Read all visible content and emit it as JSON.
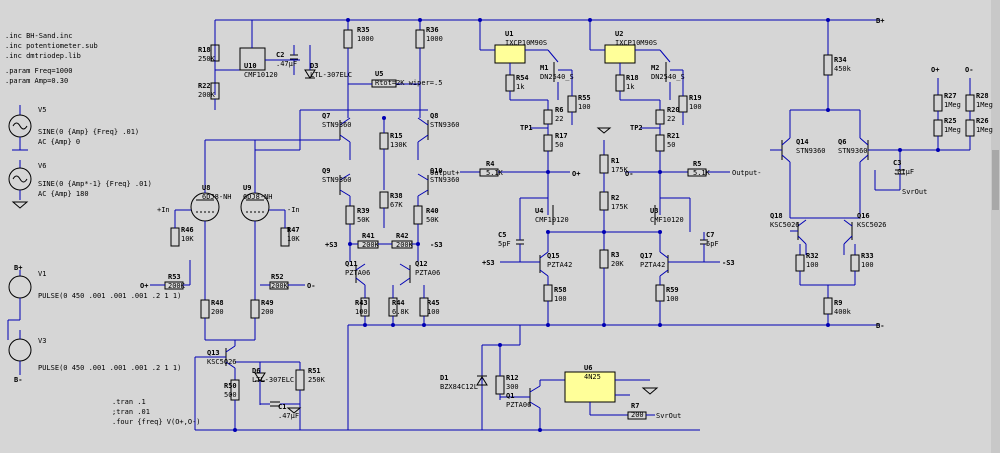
{
  "directives": {
    "inc1": ".inc BH-Sand.inc",
    "inc2": ".inc potentiometer.sub",
    "inc3": ".inc dmtriodep.lib",
    "param1": ".param Freq=1000",
    "param2": ".param Amp=0.30",
    "tran1": ".tran .1",
    "tran2": ";tran .01",
    "four": ".four {freq} V(O+,O-)"
  },
  "sources": {
    "v5": {
      "name": "V5",
      "spec": "SINE(0 {Amp} {Freq} .01)",
      "ac": "AC {Amp} 0"
    },
    "v6": {
      "name": "V6",
      "spec": "SINE(0 {Amp*-1} {Freq} .01)",
      "ac": "AC {Amp} 180"
    },
    "v1": {
      "name": "V1",
      "spec": "PULSE(0 450 .001 .001 .001 .2 1 1)"
    },
    "v3": {
      "name": "V3",
      "spec": "PULSE(0 450 .001 .001 .001 .2 1 1)"
    }
  },
  "nets": {
    "bplus": "B+",
    "bminus": "B-",
    "in_p": "+In",
    "in_m": "-In",
    "o_p": "O+",
    "o_m": "O-",
    "s3p": "+S3",
    "s3m": "-S3",
    "out_p": "Output+",
    "out_m": "Output-",
    "svrout": "SvrOut"
  },
  "components": [
    {
      "ref": "R18",
      "val": "250K"
    },
    {
      "ref": "R22",
      "val": "200K"
    },
    {
      "ref": "U10",
      "val": "CMF10120"
    },
    {
      "ref": "C2",
      "val": ".47µF"
    },
    {
      "ref": "D3",
      "val": "LTL-307ELC"
    },
    {
      "ref": "R35",
      "val": "1000"
    },
    {
      "ref": "R36",
      "val": "1000"
    },
    {
      "ref": "U5",
      "val": "Rtot=2K wiper=.5"
    },
    {
      "ref": "Q7",
      "val": "STN9360"
    },
    {
      "ref": "Q8",
      "val": "STN9360"
    },
    {
      "ref": "R15",
      "val": "130K"
    },
    {
      "ref": "Q9",
      "val": "STN9360"
    },
    {
      "ref": "Q10",
      "val": "STN9360"
    },
    {
      "ref": "R38",
      "val": "67K"
    },
    {
      "ref": "R39",
      "val": "50K"
    },
    {
      "ref": "R40",
      "val": "50K"
    },
    {
      "ref": "R41",
      "val": "200K"
    },
    {
      "ref": "R42",
      "val": "200K"
    },
    {
      "ref": "Q11",
      "val": "PZTA06"
    },
    {
      "ref": "Q12",
      "val": "PZTA06"
    },
    {
      "ref": "R43",
      "val": "100"
    },
    {
      "ref": "R44",
      "val": "6.8K"
    },
    {
      "ref": "R45",
      "val": "100"
    },
    {
      "ref": "U8",
      "val": "6DJ8-NH"
    },
    {
      "ref": "U9",
      "val": "6DJ8-NH"
    },
    {
      "ref": "R46",
      "val": "10K"
    },
    {
      "ref": "R47",
      "val": "10K"
    },
    {
      "ref": "R53",
      "val": "200K"
    },
    {
      "ref": "R52",
      "val": "200K"
    },
    {
      "ref": "R48",
      "val": "200"
    },
    {
      "ref": "R49",
      "val": "200"
    },
    {
      "ref": "Q13",
      "val": "KSC5026"
    },
    {
      "ref": "D6",
      "val": "LTL-307ELC"
    },
    {
      "ref": "R51",
      "val": "250K"
    },
    {
      "ref": "R50",
      "val": "500"
    },
    {
      "ref": "C1",
      "val": ".47µF"
    },
    {
      "ref": "U1",
      "val": "IXCP10M90S"
    },
    {
      "ref": "U2",
      "val": "IXCP10M90S"
    },
    {
      "ref": "R54",
      "val": "1k"
    },
    {
      "ref": "R18b",
      "val": "1k"
    },
    {
      "ref": "M1",
      "val": "DN2540_S"
    },
    {
      "ref": "M2",
      "val": "DN2540_S"
    },
    {
      "ref": "R6",
      "val": "22"
    },
    {
      "ref": "R20",
      "val": "22"
    },
    {
      "ref": "R55",
      "val": "100"
    },
    {
      "ref": "R19",
      "val": "100"
    },
    {
      "ref": "R17",
      "val": "50"
    },
    {
      "ref": "R21",
      "val": "50"
    },
    {
      "ref": "TP1",
      "val": ""
    },
    {
      "ref": "TP2",
      "val": ""
    },
    {
      "ref": "R4",
      "val": "5.1K"
    },
    {
      "ref": "R5",
      "val": "5.1K"
    },
    {
      "ref": "R1",
      "val": "175K"
    },
    {
      "ref": "R2",
      "val": "175K"
    },
    {
      "ref": "U4",
      "val": "CMF10120"
    },
    {
      "ref": "U3",
      "val": "CMF10120"
    },
    {
      "ref": "C5",
      "val": "5pF"
    },
    {
      "ref": "C7",
      "val": "5pF"
    },
    {
      "ref": "Q15",
      "val": "PZTA42"
    },
    {
      "ref": "Q17",
      "val": "PZTA42"
    },
    {
      "ref": "R3",
      "val": "20K"
    },
    {
      "ref": "R58",
      "val": "100"
    },
    {
      "ref": "R59",
      "val": "100"
    },
    {
      "ref": "D1",
      "val": "BZX84C12L"
    },
    {
      "ref": "R12",
      "val": "300"
    },
    {
      "ref": "Q1",
      "val": "PZTA06"
    },
    {
      "ref": "U6",
      "val": "4N25"
    },
    {
      "ref": "R7",
      "val": "200"
    },
    {
      "ref": "R34",
      "val": "450k"
    },
    {
      "ref": "Q14",
      "val": "STN9360"
    },
    {
      "ref": "Q6",
      "val": "STN9360"
    },
    {
      "ref": "Q18",
      "val": "KSC5026"
    },
    {
      "ref": "Q16",
      "val": "KSC5026"
    },
    {
      "ref": "R32",
      "val": "100"
    },
    {
      "ref": "R33",
      "val": "100"
    },
    {
      "ref": "R9",
      "val": "400k"
    },
    {
      "ref": "C3",
      "val": ".01µF"
    },
    {
      "ref": "R27",
      "val": "1Meg"
    },
    {
      "ref": "R28",
      "val": "1Meg"
    },
    {
      "ref": "R25",
      "val": "1Meg"
    },
    {
      "ref": "R26",
      "val": "1Meg"
    }
  ]
}
